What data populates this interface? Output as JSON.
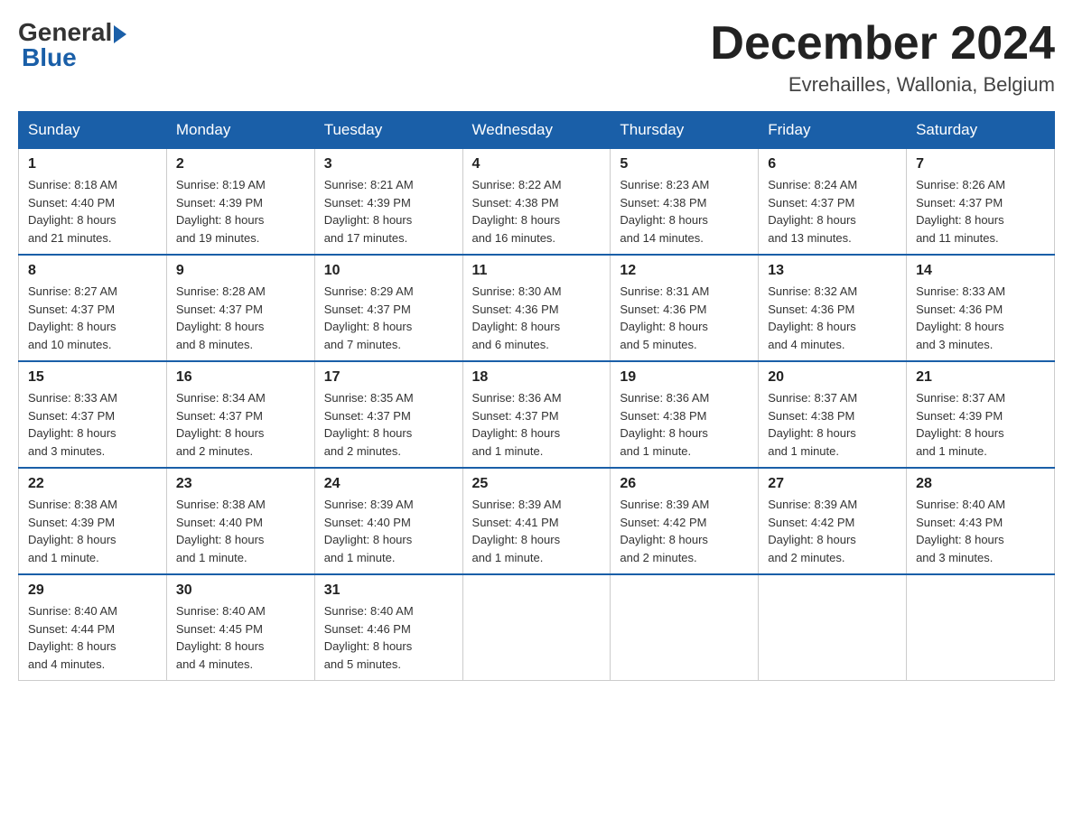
{
  "header": {
    "logo_general": "General",
    "logo_blue": "Blue",
    "month_title": "December 2024",
    "location": "Evrehailles, Wallonia, Belgium"
  },
  "weekdays": [
    "Sunday",
    "Monday",
    "Tuesday",
    "Wednesday",
    "Thursday",
    "Friday",
    "Saturday"
  ],
  "weeks": [
    [
      {
        "day": "1",
        "sunrise": "8:18 AM",
        "sunset": "4:40 PM",
        "daylight": "8 hours and 21 minutes."
      },
      {
        "day": "2",
        "sunrise": "8:19 AM",
        "sunset": "4:39 PM",
        "daylight": "8 hours and 19 minutes."
      },
      {
        "day": "3",
        "sunrise": "8:21 AM",
        "sunset": "4:39 PM",
        "daylight": "8 hours and 17 minutes."
      },
      {
        "day": "4",
        "sunrise": "8:22 AM",
        "sunset": "4:38 PM",
        "daylight": "8 hours and 16 minutes."
      },
      {
        "day": "5",
        "sunrise": "8:23 AM",
        "sunset": "4:38 PM",
        "daylight": "8 hours and 14 minutes."
      },
      {
        "day": "6",
        "sunrise": "8:24 AM",
        "sunset": "4:37 PM",
        "daylight": "8 hours and 13 minutes."
      },
      {
        "day": "7",
        "sunrise": "8:26 AM",
        "sunset": "4:37 PM",
        "daylight": "8 hours and 11 minutes."
      }
    ],
    [
      {
        "day": "8",
        "sunrise": "8:27 AM",
        "sunset": "4:37 PM",
        "daylight": "8 hours and 10 minutes."
      },
      {
        "day": "9",
        "sunrise": "8:28 AM",
        "sunset": "4:37 PM",
        "daylight": "8 hours and 8 minutes."
      },
      {
        "day": "10",
        "sunrise": "8:29 AM",
        "sunset": "4:37 PM",
        "daylight": "8 hours and 7 minutes."
      },
      {
        "day": "11",
        "sunrise": "8:30 AM",
        "sunset": "4:36 PM",
        "daylight": "8 hours and 6 minutes."
      },
      {
        "day": "12",
        "sunrise": "8:31 AM",
        "sunset": "4:36 PM",
        "daylight": "8 hours and 5 minutes."
      },
      {
        "day": "13",
        "sunrise": "8:32 AM",
        "sunset": "4:36 PM",
        "daylight": "8 hours and 4 minutes."
      },
      {
        "day": "14",
        "sunrise": "8:33 AM",
        "sunset": "4:36 PM",
        "daylight": "8 hours and 3 minutes."
      }
    ],
    [
      {
        "day": "15",
        "sunrise": "8:33 AM",
        "sunset": "4:37 PM",
        "daylight": "8 hours and 3 minutes."
      },
      {
        "day": "16",
        "sunrise": "8:34 AM",
        "sunset": "4:37 PM",
        "daylight": "8 hours and 2 minutes."
      },
      {
        "day": "17",
        "sunrise": "8:35 AM",
        "sunset": "4:37 PM",
        "daylight": "8 hours and 2 minutes."
      },
      {
        "day": "18",
        "sunrise": "8:36 AM",
        "sunset": "4:37 PM",
        "daylight": "8 hours and 1 minute."
      },
      {
        "day": "19",
        "sunrise": "8:36 AM",
        "sunset": "4:38 PM",
        "daylight": "8 hours and 1 minute."
      },
      {
        "day": "20",
        "sunrise": "8:37 AM",
        "sunset": "4:38 PM",
        "daylight": "8 hours and 1 minute."
      },
      {
        "day": "21",
        "sunrise": "8:37 AM",
        "sunset": "4:39 PM",
        "daylight": "8 hours and 1 minute."
      }
    ],
    [
      {
        "day": "22",
        "sunrise": "8:38 AM",
        "sunset": "4:39 PM",
        "daylight": "8 hours and 1 minute."
      },
      {
        "day": "23",
        "sunrise": "8:38 AM",
        "sunset": "4:40 PM",
        "daylight": "8 hours and 1 minute."
      },
      {
        "day": "24",
        "sunrise": "8:39 AM",
        "sunset": "4:40 PM",
        "daylight": "8 hours and 1 minute."
      },
      {
        "day": "25",
        "sunrise": "8:39 AM",
        "sunset": "4:41 PM",
        "daylight": "8 hours and 1 minute."
      },
      {
        "day": "26",
        "sunrise": "8:39 AM",
        "sunset": "4:42 PM",
        "daylight": "8 hours and 2 minutes."
      },
      {
        "day": "27",
        "sunrise": "8:39 AM",
        "sunset": "4:42 PM",
        "daylight": "8 hours and 2 minutes."
      },
      {
        "day": "28",
        "sunrise": "8:40 AM",
        "sunset": "4:43 PM",
        "daylight": "8 hours and 3 minutes."
      }
    ],
    [
      {
        "day": "29",
        "sunrise": "8:40 AM",
        "sunset": "4:44 PM",
        "daylight": "8 hours and 4 minutes."
      },
      {
        "day": "30",
        "sunrise": "8:40 AM",
        "sunset": "4:45 PM",
        "daylight": "8 hours and 4 minutes."
      },
      {
        "day": "31",
        "sunrise": "8:40 AM",
        "sunset": "4:46 PM",
        "daylight": "8 hours and 5 minutes."
      },
      null,
      null,
      null,
      null
    ]
  ],
  "labels": {
    "sunrise": "Sunrise:",
    "sunset": "Sunset:",
    "daylight": "Daylight:"
  }
}
